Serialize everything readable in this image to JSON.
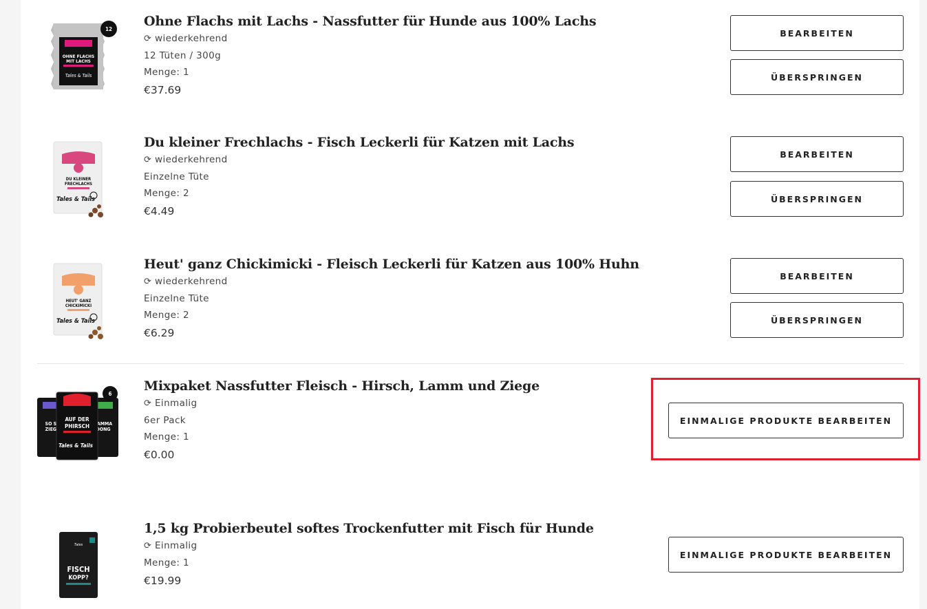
{
  "items": [
    {
      "title": "Ohne Flachs mit Lachs - Nassfutter für Hunde aus 100% Lachs",
      "frequency": "wiederkehrend",
      "variant": "12 Tüten / 300g",
      "quantity": "Menge: 1",
      "price": "€37.69",
      "buttons": {
        "edit": "BEARBEITEN",
        "skip": "ÜBERSPRINGEN"
      },
      "image": {
        "label_line1": "OHNE FLACHS",
        "label_line2": "MIT LACHS",
        "brand": "Tales & Tails",
        "badge": "12er Pack",
        "accent": "#e0197d",
        "bag": "#b9b9b9"
      }
    },
    {
      "title": "Du kleiner Frechlachs - Fisch Leckerli für Katzen mit Lachs",
      "frequency": "wiederkehrend",
      "variant": "Einzelne Tüte",
      "quantity": "Menge: 2",
      "price": "€4.49",
      "buttons": {
        "edit": "BEARBEITEN",
        "skip": "ÜBERSPRINGEN"
      },
      "image": {
        "label_line1": "DU KLEINER",
        "label_line2": "FRECHLACHS",
        "brand": "Tales & Tails",
        "accent": "#d9477f",
        "bag": "#efefef"
      }
    },
    {
      "title": "Heut' ganz Chickimicki - Fleisch Leckerli für Katzen aus 100% Huhn",
      "frequency": "wiederkehrend",
      "variant": "Einzelne Tüte",
      "quantity": "Menge: 2",
      "price": "€6.29",
      "buttons": {
        "edit": "BEARBEITEN",
        "skip": "ÜBERSPRINGEN"
      },
      "image": {
        "label_line1": "HEUT' GANZ",
        "label_line2": "CHICKIMICKI",
        "brand": "Tales & Tails",
        "accent": "#f2a06b",
        "bag": "#efefef"
      }
    },
    {
      "title": "Mixpaket Nassfutter Fleisch - Hirsch, Lamm und Ziege",
      "frequency": "Einmalig",
      "variant": "6er Pack",
      "quantity": "Menge: 1",
      "price": "€0.00",
      "buttons": {
        "onetime": "EINMALIGE PRODUKTE BEARBEITEN"
      },
      "image": {
        "left": "SO SE ZIEGE",
        "center_line1": "AUF DER",
        "center_line2": "PHIRSCH",
        "right": "LAMMA DONG",
        "brand": "Tales & Tails",
        "badge": "6er Pack",
        "accent": "#e0202c"
      }
    },
    {
      "title": "1,5 kg Probierbeutel softes Trockenfutter mit Fisch für Hunde",
      "frequency": "Einmalig",
      "quantity": "Menge: 1",
      "price": "€19.99",
      "buttons": {
        "onetime": "EINMALIGE PRODUKTE BEARBEITEN"
      },
      "image": {
        "label_line1": "FISCH",
        "label_line2": "KOPP?",
        "brand": "Tales & Tails",
        "accent": "#1e8a8a",
        "bag": "#1b1b1b"
      }
    }
  ]
}
